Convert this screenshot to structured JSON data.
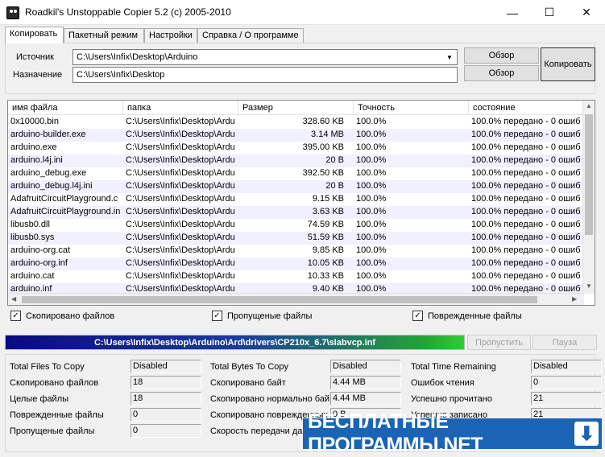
{
  "window": {
    "title": "Roadkil's Unstoppable Copier 5.2 (c) 2005-2010",
    "minimize_glyph": "—",
    "maximize_glyph": "☐",
    "close_glyph": "✕"
  },
  "tabs": [
    {
      "label": "Копировать",
      "active": true
    },
    {
      "label": "Пакетный режим",
      "active": false
    },
    {
      "label": "Настройки",
      "active": false
    },
    {
      "label": "Справка / О программе",
      "active": false
    }
  ],
  "copy_panel": {
    "source_label": "Источник",
    "source_value": "C:\\Users\\Infix\\Desktop\\Arduino",
    "dest_label": "Назначение",
    "dest_value": "C:\\Users\\Infix\\Desktop",
    "browse_label": "Обзор",
    "copy_label": "Копировать",
    "dropdown_glyph": "▼"
  },
  "file_list": {
    "columns": [
      "имя файла",
      "папка",
      "Размер",
      "Точность",
      "состояние"
    ],
    "rows": [
      [
        "0x10000.bin",
        "C:\\Users\\Infix\\Desktop\\Ardu",
        "328.60 KB",
        "100.0%",
        "100.0% передано - 0 ошиб"
      ],
      [
        "arduino-builder.exe",
        "C:\\Users\\Infix\\Desktop\\Ardu",
        "3.14 MB",
        "100.0%",
        "100.0% передано - 0 ошиб"
      ],
      [
        "arduino.exe",
        "C:\\Users\\Infix\\Desktop\\Ardu",
        "395.00 KB",
        "100.0%",
        "100.0% передано - 0 ошиб"
      ],
      [
        "arduino.l4j.ini",
        "C:\\Users\\Infix\\Desktop\\Ardu",
        "20 B",
        "100.0%",
        "100.0% передано - 0 ошиб"
      ],
      [
        "arduino_debug.exe",
        "C:\\Users\\Infix\\Desktop\\Ardu",
        "392.50 KB",
        "100.0%",
        "100.0% передано - 0 ошиб"
      ],
      [
        "arduino_debug.l4j.ini",
        "C:\\Users\\Infix\\Desktop\\Ardu",
        "20 B",
        "100.0%",
        "100.0% передано - 0 ошиб"
      ],
      [
        "AdafruitCircuitPlayground.c",
        "C:\\Users\\Infix\\Desktop\\Ardu",
        "9.15 KB",
        "100.0%",
        "100.0% передано - 0 ошиб"
      ],
      [
        "AdafruitCircuitPlayground.in",
        "C:\\Users\\Infix\\Desktop\\Ardu",
        "3.63 KB",
        "100.0%",
        "100.0% передано - 0 ошиб"
      ],
      [
        "libusb0.dll",
        "C:\\Users\\Infix\\Desktop\\Ardu",
        "74.59 KB",
        "100.0%",
        "100.0% передано - 0 ошиб"
      ],
      [
        "libusb0.sys",
        "C:\\Users\\Infix\\Desktop\\Ardu",
        "51.59 KB",
        "100.0%",
        "100.0% передано - 0 ошиб"
      ],
      [
        "arduino-org.cat",
        "C:\\Users\\Infix\\Desktop\\Ardu",
        "9.85 KB",
        "100.0%",
        "100.0% передано - 0 ошиб"
      ],
      [
        "arduino-org.inf",
        "C:\\Users\\Infix\\Desktop\\Ardu",
        "10.05 KB",
        "100.0%",
        "100.0% передано - 0 ошиб"
      ],
      [
        "arduino.cat",
        "C:\\Users\\Infix\\Desktop\\Ardu",
        "10.33 KB",
        "100.0%",
        "100.0% передано - 0 ошиб"
      ],
      [
        "arduino.inf",
        "C:\\Users\\Infix\\Desktop\\Ardu",
        "9.40 KB",
        "100.0%",
        "100.0% передано - 0 ошиб"
      ]
    ]
  },
  "checkboxes": [
    {
      "label": "Скопировано файлов",
      "checked": true
    },
    {
      "label": "Пропущеные файлы",
      "checked": true
    },
    {
      "label": "Поврежденные файлы",
      "checked": true
    }
  ],
  "progress": {
    "path": "C:\\Users\\Infix\\Desktop\\Arduino\\Ard\\drivers\\CP210x_6.7\\slabvcp.inf",
    "fraction": 1.0,
    "skip_label": "Пропустить",
    "pause_label": "Пауза"
  },
  "stats": {
    "col1": [
      {
        "label": "Total Files To Copy",
        "value": "Disabled"
      },
      {
        "label": "Скопировано файлов",
        "value": "18"
      },
      {
        "label": "Целые файлы",
        "value": "18"
      },
      {
        "label": "Поврежденные файлы",
        "value": "0"
      },
      {
        "label": "Пропущеные файлы",
        "value": "0"
      }
    ],
    "col2": [
      {
        "label": "Total Bytes To Copy",
        "value": "Disabled"
      },
      {
        "label": "Скопировано байт",
        "value": "4.44 MB"
      },
      {
        "label": "Скопировано нормально байт",
        "value": "4.44 MB"
      },
      {
        "label": "Скопировано поврежденных",
        "value": "0 B"
      },
      {
        "label": "Скорость передачи данных",
        "value": ""
      }
    ],
    "col3": [
      {
        "label": "Total Time Remaining",
        "value": "Disabled"
      },
      {
        "label": "Ошибок чтения",
        "value": "0"
      },
      {
        "label": "Успешно прочитано",
        "value": "21"
      },
      {
        "label": "Успешно записано",
        "value": "21"
      },
      {
        "label": "",
        "value": ""
      }
    ]
  },
  "watermark": {
    "text": "БЕСПЛАТНЫЕ ПРОГРАММЫ.NET",
    "arrow_glyph": "⬇"
  },
  "scroll": {
    "up_glyph": "▲",
    "down_glyph": "▼",
    "left_glyph": "◀",
    "right_glyph": "▶"
  },
  "check_glyph": "✓"
}
